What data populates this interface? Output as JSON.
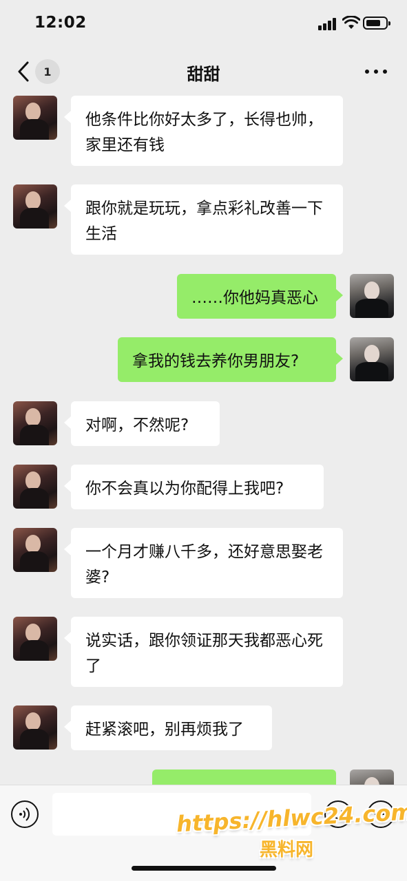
{
  "status_bar": {
    "time": "12:02"
  },
  "header": {
    "back_badge": "1",
    "title": "甜甜"
  },
  "messages": [
    {
      "side": "in",
      "text": "他条件比你好太多了，长得也帅，家里还有钱"
    },
    {
      "side": "in",
      "text": "跟你就是玩玩，拿点彩礼改善一下生活"
    },
    {
      "side": "out",
      "text": "……你他妈真恶心"
    },
    {
      "side": "out",
      "text": "拿我的钱去养你男朋友?"
    },
    {
      "side": "in",
      "text": "对啊，不然呢?"
    },
    {
      "side": "in",
      "text": "你不会真以为你配得上我吧?"
    },
    {
      "side": "in",
      "text": "一个月才赚八千多，还好意思娶老婆?"
    },
    {
      "side": "in",
      "text": "说实话，跟你领证那天我都恶心死了"
    },
    {
      "side": "in",
      "text": "赶紧滚吧，别再烦我了"
    },
    {
      "side": "out",
      "text": ""
    }
  ],
  "input": {
    "value": ""
  },
  "watermark": {
    "url": "https://hlwc24.com",
    "name": "黑料网"
  }
}
